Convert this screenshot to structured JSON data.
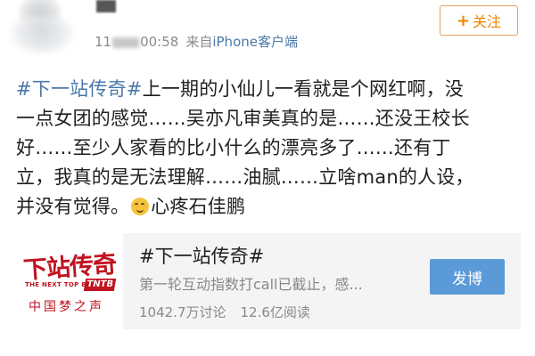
{
  "header": {
    "time_suffix": "00:58",
    "source_prefix": "来自",
    "source_name": "iPhone客户端",
    "follow_label": "关注",
    "follow_plus": "+"
  },
  "post": {
    "hashtag": "#下一站传奇#",
    "line1_rest": "上一期的小仙儿一看就是个网红啊，没",
    "line2": "一点女团的感觉……吴亦凡审美真的是……还没王校长",
    "line3": "好……至少人家看的比小什么的漂亮多了……还有丁",
    "line4": "立，我真的是无法理解……油腻……立啥man的人设，",
    "line5_before_emoji": "并没有觉得。",
    "line5_after_emoji": "心疼石佳鹏",
    "emoji_name": "upside-down-face-icon"
  },
  "card": {
    "logo_title": "下站传奇",
    "logo_sub": "THE NEXT TOP BANG",
    "logo_badge": "TNTB",
    "logo_bottom": "中国梦之声",
    "title": "#下一站传奇#",
    "description": "第一轮互动指数打call已截止，感...",
    "discussions": "1042.7万讨论",
    "reads": "12.6亿阅读",
    "post_button": "发博"
  },
  "colors": {
    "link_blue": "#4a78a8",
    "follow_orange": "#f08300",
    "button_blue": "#5a9ad8",
    "logo_red": "#c1121f"
  }
}
